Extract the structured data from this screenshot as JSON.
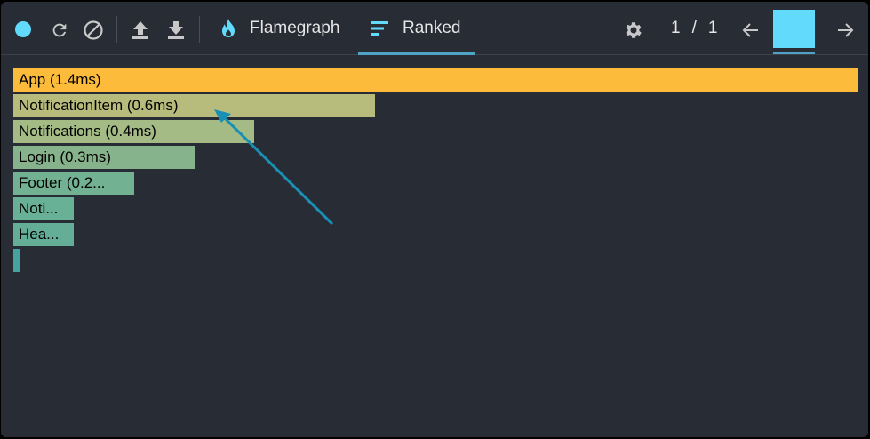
{
  "toolbar": {
    "tabs": [
      {
        "label": "Flamegraph",
        "icon": "flame-icon",
        "active": false
      },
      {
        "label": "Ranked",
        "icon": "ranked-icon",
        "active": true
      }
    ],
    "pager": {
      "current": "1",
      "separator": "/",
      "total": "1"
    },
    "record_color": "#61dafb",
    "commit_color": "#61dafb",
    "accent_color": "#4fa3c7"
  },
  "chart_data": {
    "type": "bar",
    "orientation": "horizontal",
    "unit": "ms",
    "max": 1.4,
    "bars": [
      {
        "name": "App",
        "label": "App (1.4ms)",
        "value": 1.4,
        "color": "#fdbb3c"
      },
      {
        "name": "NotificationItem",
        "label": "NotificationItem (0.6ms)",
        "value": 0.6,
        "color": "#b7bc7c"
      },
      {
        "name": "Notifications",
        "label": "Notifications (0.4ms)",
        "value": 0.4,
        "color": "#a4bb85"
      },
      {
        "name": "Login",
        "label": "Login (0.3ms)",
        "value": 0.3,
        "color": "#86b38b"
      },
      {
        "name": "Footer",
        "label": "Footer (0.2...",
        "value": 0.2,
        "color": "#72b191"
      },
      {
        "name": "Noti...",
        "label": "Noti...",
        "value": 0.1,
        "color": "#68b196"
      },
      {
        "name": "Hea...",
        "label": "Hea...",
        "value": 0.1,
        "color": "#64ae98"
      },
      {
        "name": "",
        "label": "",
        "value": 0.01,
        "color": "#45a4a0"
      }
    ]
  }
}
